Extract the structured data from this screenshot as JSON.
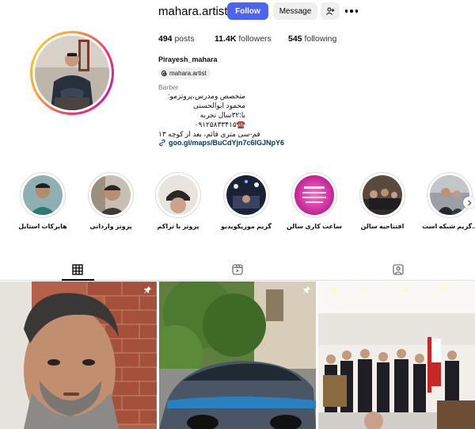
{
  "header": {
    "username": "mahara.artist",
    "follow_label": "Follow",
    "message_label": "Message"
  },
  "stats": {
    "posts_count": "494",
    "posts_label": "posts",
    "followers_count": "11.4K",
    "followers_label": "followers",
    "following_count": "545",
    "following_label": "following"
  },
  "bio": {
    "full_name": "Pirayesh_mahara",
    "threads_handle": "mahara.artist",
    "category": "Barber",
    "lines": [
      "متخصص ومدرس،پروتزمو:",
      "محمود ابوالحسنی",
      "با:۳۲سال تجربه",
      "☎️۰۹۱۲۵۸۳۳۴۱۵",
      "قم-سی متری قائم، بعد از کوچه ۱۳"
    ],
    "link": "goo.gl/maps/BuCdYjn7c6lGJNpY6"
  },
  "highlights": [
    {
      "label": "هایرکات استایل"
    },
    {
      "label": "پروتز وارداتی"
    },
    {
      "label": "پروتز با تراکم"
    },
    {
      "label": "گریم موزیکویدیو"
    },
    {
      "label": "ساعت کاری سالن"
    },
    {
      "label": "افتتاحیه سالن"
    },
    {
      "label": "گریم شبکه است..."
    }
  ],
  "icons": {
    "suggest": "person-add-icon",
    "more": "more-options-icon",
    "threads": "threads-icon",
    "link": "link-icon",
    "posts_tab": "grid-icon",
    "reels_tab": "reels-icon",
    "tagged_tab": "tagged-icon",
    "pinned": "pin-icon",
    "next": "chevron-right-icon"
  },
  "colors": {
    "follow_button": "#4c63f5",
    "link": "#00376b"
  }
}
